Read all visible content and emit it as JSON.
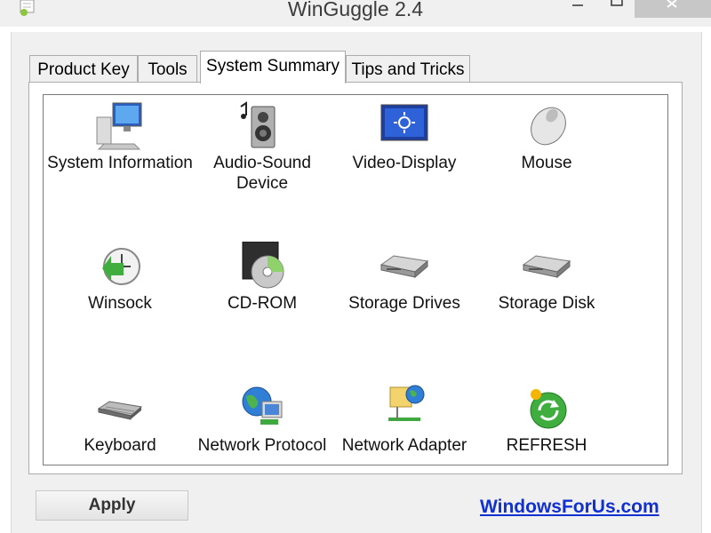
{
  "window": {
    "title": "WinGuggle 2.4"
  },
  "tabs": [
    {
      "label": "Product Key",
      "active": false
    },
    {
      "label": "Tools",
      "active": false
    },
    {
      "label": "System Summary",
      "active": true
    },
    {
      "label": "Tips and Tricks",
      "active": false
    }
  ],
  "summary_items": [
    {
      "label": "System Information",
      "icon": "computer-icon"
    },
    {
      "label": "Audio-Sound Device",
      "icon": "speaker-icon"
    },
    {
      "label": "Video-Display",
      "icon": "display-icon"
    },
    {
      "label": "Mouse",
      "icon": "mouse-icon"
    },
    {
      "label": "Winsock",
      "icon": "clock-arrow-icon"
    },
    {
      "label": "CD-ROM",
      "icon": "cd-rom-icon"
    },
    {
      "label": "Storage Drives",
      "icon": "hard-drive-icon"
    },
    {
      "label": "Storage Disk",
      "icon": "hard-disk-icon"
    },
    {
      "label": "Keyboard",
      "icon": "keyboard-icon"
    },
    {
      "label": "Network Protocol",
      "icon": "globe-network-icon"
    },
    {
      "label": "Network Adapter",
      "icon": "network-adapter-icon"
    },
    {
      "label": "REFRESH",
      "icon": "refresh-icon"
    }
  ],
  "footer": {
    "apply_label": "Apply",
    "link_text": "WindowsForUs.com"
  },
  "colors": {
    "link": "#1030d0",
    "window_bg": "#f0f0f0",
    "close_button": "#c7c7c7"
  }
}
